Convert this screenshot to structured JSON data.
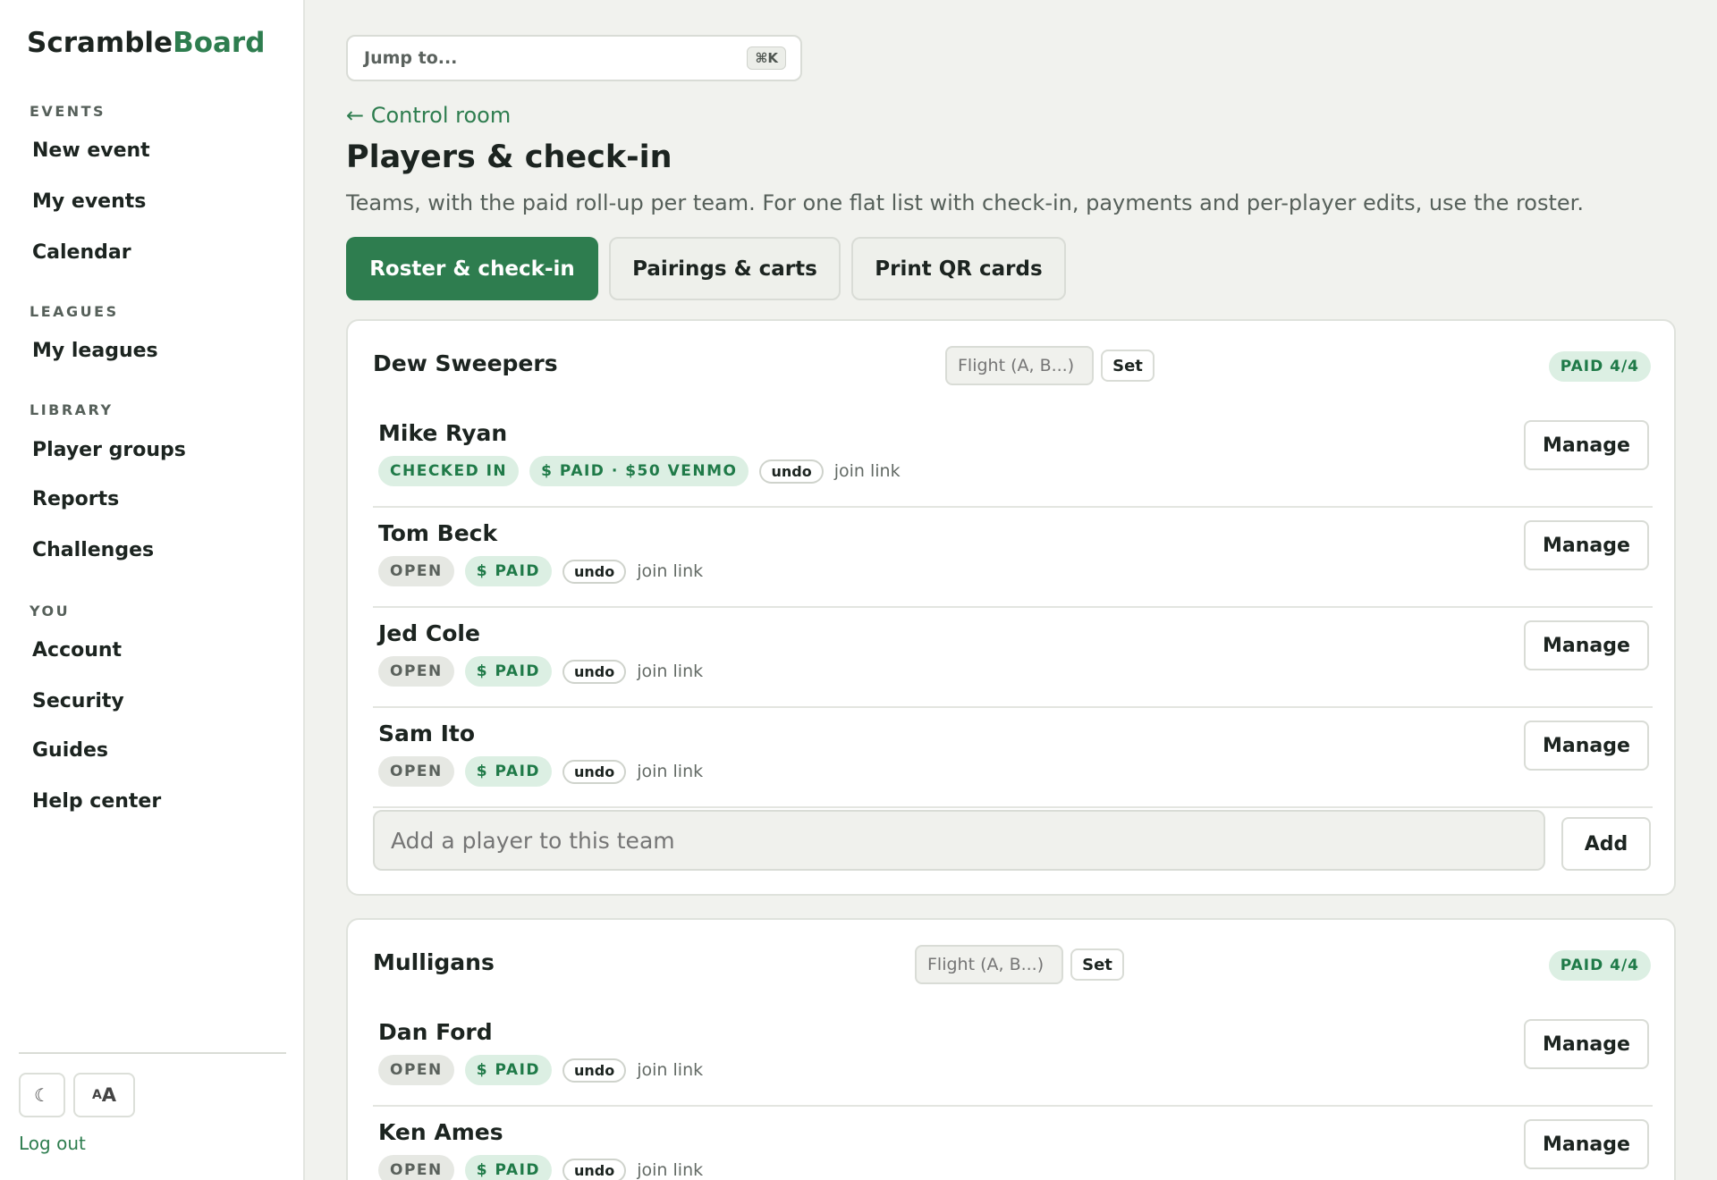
{
  "brand": {
    "part1": "Scramble",
    "part2": "Board"
  },
  "sidebar": {
    "sections": [
      {
        "title": "EVENTS",
        "items": [
          "New event",
          "My events",
          "Calendar"
        ]
      },
      {
        "title": "LEAGUES",
        "items": [
          "My leagues"
        ]
      },
      {
        "title": "LIBRARY",
        "items": [
          "Player groups",
          "Reports",
          "Challenges"
        ]
      },
      {
        "title": "YOU",
        "items": [
          "Account",
          "Security",
          "Guides",
          "Help center"
        ]
      }
    ],
    "theme_icon": "☾",
    "textsize_small": "A",
    "textsize_large": "A",
    "logout": "Log out"
  },
  "search": {
    "placeholder": "Jump to...",
    "shortcut": "⌘K"
  },
  "back_link": "← Control room",
  "page": {
    "title": "Players & check-in",
    "subtitle": "Teams, with the paid roll-up per team. For one flat list with check-in, payments and per-player edits, use the roster."
  },
  "tabs": [
    "Roster & check-in",
    "Pairings & carts",
    "Print QR cards"
  ],
  "common": {
    "flight_placeholder": "Flight (A, B...)",
    "set_label": "Set",
    "manage_label": "Manage",
    "undo_label": "undo",
    "join_link_label": "join link",
    "add_placeholder": "Add a player to this team",
    "add_label": "Add"
  },
  "teams": [
    {
      "name": "Dew Sweepers",
      "paid_badge": "PAID 4/4",
      "players": [
        {
          "name": "Mike Ryan",
          "status": "CHECKED IN",
          "payment": "$ PAID · $50 VENMO"
        },
        {
          "name": "Tom Beck",
          "status": "OPEN",
          "payment": "$ PAID"
        },
        {
          "name": "Jed Cole",
          "status": "OPEN",
          "payment": "$ PAID"
        },
        {
          "name": "Sam Ito",
          "status": "OPEN",
          "payment": "$ PAID"
        }
      ]
    },
    {
      "name": "Mulligans",
      "paid_badge": "PAID 4/4",
      "players": [
        {
          "name": "Dan Ford",
          "status": "OPEN",
          "payment": "$ PAID"
        },
        {
          "name": "Ken Ames",
          "status": "OPEN",
          "payment": "$ PAID"
        }
      ]
    }
  ]
}
